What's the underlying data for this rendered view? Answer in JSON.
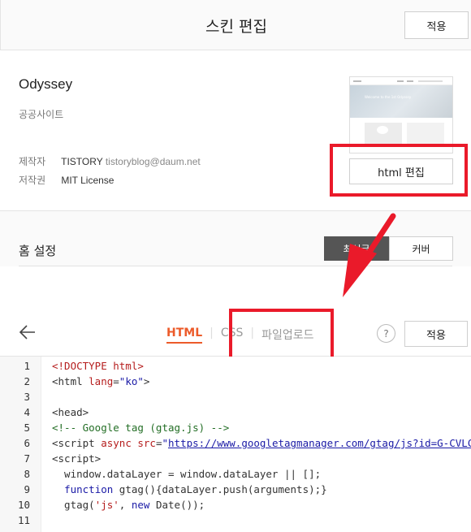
{
  "header": {
    "title": "스킨 편집",
    "apply_label": "적용"
  },
  "skin": {
    "name": "Odyssey",
    "subtitle": "공공사이트",
    "maker_key": "제작자",
    "maker_name": "TISTORY",
    "maker_email": "tistoryblog@daum.net",
    "license_key": "저작권",
    "license_value": "MIT License",
    "html_edit_label": "html 편집",
    "thumb_hero_text": "Welcome to the 1st Odyssey"
  },
  "home": {
    "label": "홈 설정",
    "option_latest": "최신글",
    "option_cover": "커버"
  },
  "editor": {
    "tabs": [
      {
        "label": "HTML",
        "active": true
      },
      {
        "label": "CSS",
        "active": false
      },
      {
        "label": "파일업로드",
        "active": false
      }
    ],
    "help_label": "?",
    "apply_label": "적용",
    "lines": [
      {
        "n": "1",
        "parts": [
          {
            "t": "<!DOCTYPE html>",
            "c": "tag"
          }
        ]
      },
      {
        "n": "2",
        "parts": [
          {
            "t": "<html ",
            "c": "plain"
          },
          {
            "t": "lang",
            "c": "attr"
          },
          {
            "t": "=",
            "c": "plain"
          },
          {
            "t": "\"ko\"",
            "c": "str"
          },
          {
            "t": ">",
            "c": "plain"
          }
        ]
      },
      {
        "n": "3",
        "parts": []
      },
      {
        "n": "4",
        "parts": [
          {
            "t": "<head>",
            "c": "plain"
          }
        ]
      },
      {
        "n": "5",
        "parts": [
          {
            "t": "<!-- Google tag (gtag.js) -->",
            "c": "comment"
          }
        ]
      },
      {
        "n": "6",
        "parts": [
          {
            "t": "<script ",
            "c": "plain"
          },
          {
            "t": "async src",
            "c": "attr"
          },
          {
            "t": "=",
            "c": "plain"
          },
          {
            "t": "\"",
            "c": "str"
          },
          {
            "t": "https://www.googletagmanager.com/gtag/js?id=G-CVLCG",
            "c": "link"
          }
        ]
      },
      {
        "n": "7",
        "parts": [
          {
            "t": "<script>",
            "c": "plain"
          }
        ]
      },
      {
        "n": "8",
        "parts": [
          {
            "t": "  window.dataLayer = window.dataLayer || [];",
            "c": "plain"
          }
        ]
      },
      {
        "n": "9",
        "parts": [
          {
            "t": "  ",
            "c": "plain"
          },
          {
            "t": "function",
            "c": "kw"
          },
          {
            "t": " gtag(){dataLayer.push(arguments);}",
            "c": "plain"
          }
        ]
      },
      {
        "n": "10",
        "parts": [
          {
            "t": "  gtag(",
            "c": "plain"
          },
          {
            "t": "'js'",
            "c": "tag"
          },
          {
            "t": ", ",
            "c": "plain"
          },
          {
            "t": "new",
            "c": "kw"
          },
          {
            "t": " Date());",
            "c": "plain"
          }
        ]
      },
      {
        "n": "11",
        "parts": []
      }
    ]
  },
  "colors": {
    "accent": "#ec5b2a",
    "annotation": "#ea1a2a",
    "segment_active": "#555555"
  },
  "icons": {
    "back": "arrow-left-icon",
    "help": "question-circle-icon",
    "annotation_arrow": "red-arrow-icon"
  }
}
